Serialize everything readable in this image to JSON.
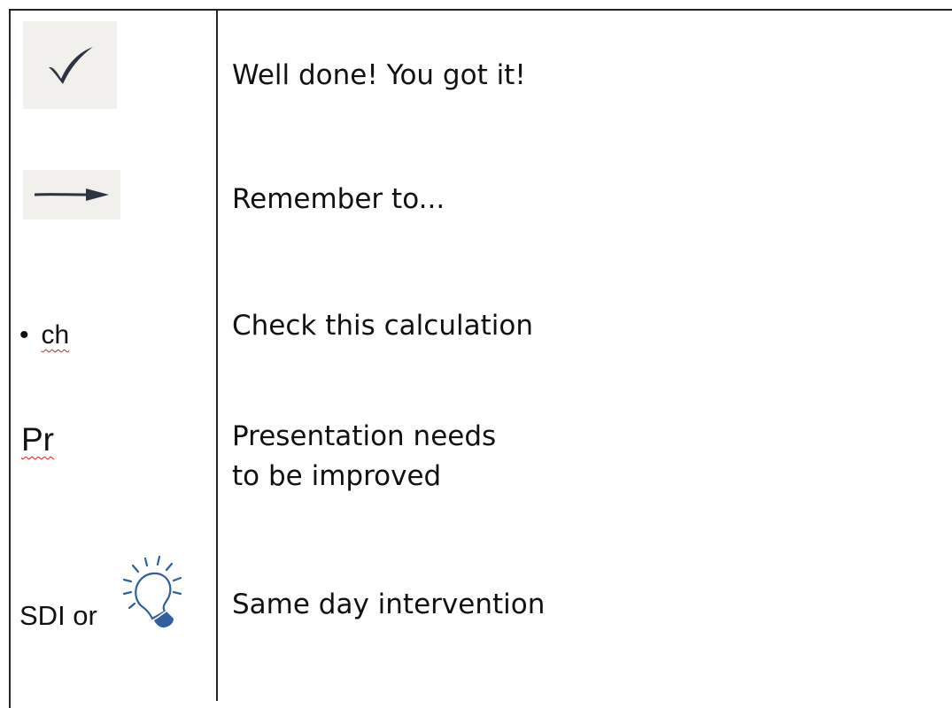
{
  "rows": [
    {
      "symbol_icon": "checkmark-icon",
      "meaning": "Well done! You got it!"
    },
    {
      "symbol_icon": "arrow-right-icon",
      "meaning": "Remember to..."
    },
    {
      "symbol_bullet": "•",
      "symbol_text": "ch",
      "meaning": "Check this calculation"
    },
    {
      "symbol_text": "Pr",
      "meaning_line1": "Presentation needs",
      "meaning_line2": "to be improved"
    },
    {
      "symbol_text": "SDI or",
      "symbol_icon": "lightbulb-icon",
      "meaning": "Same day intervention"
    }
  ],
  "colors": {
    "border": "#222222",
    "tile": "#f1f0ec",
    "spellcheck": "#d32020",
    "bulb": "#2f5f9e"
  }
}
